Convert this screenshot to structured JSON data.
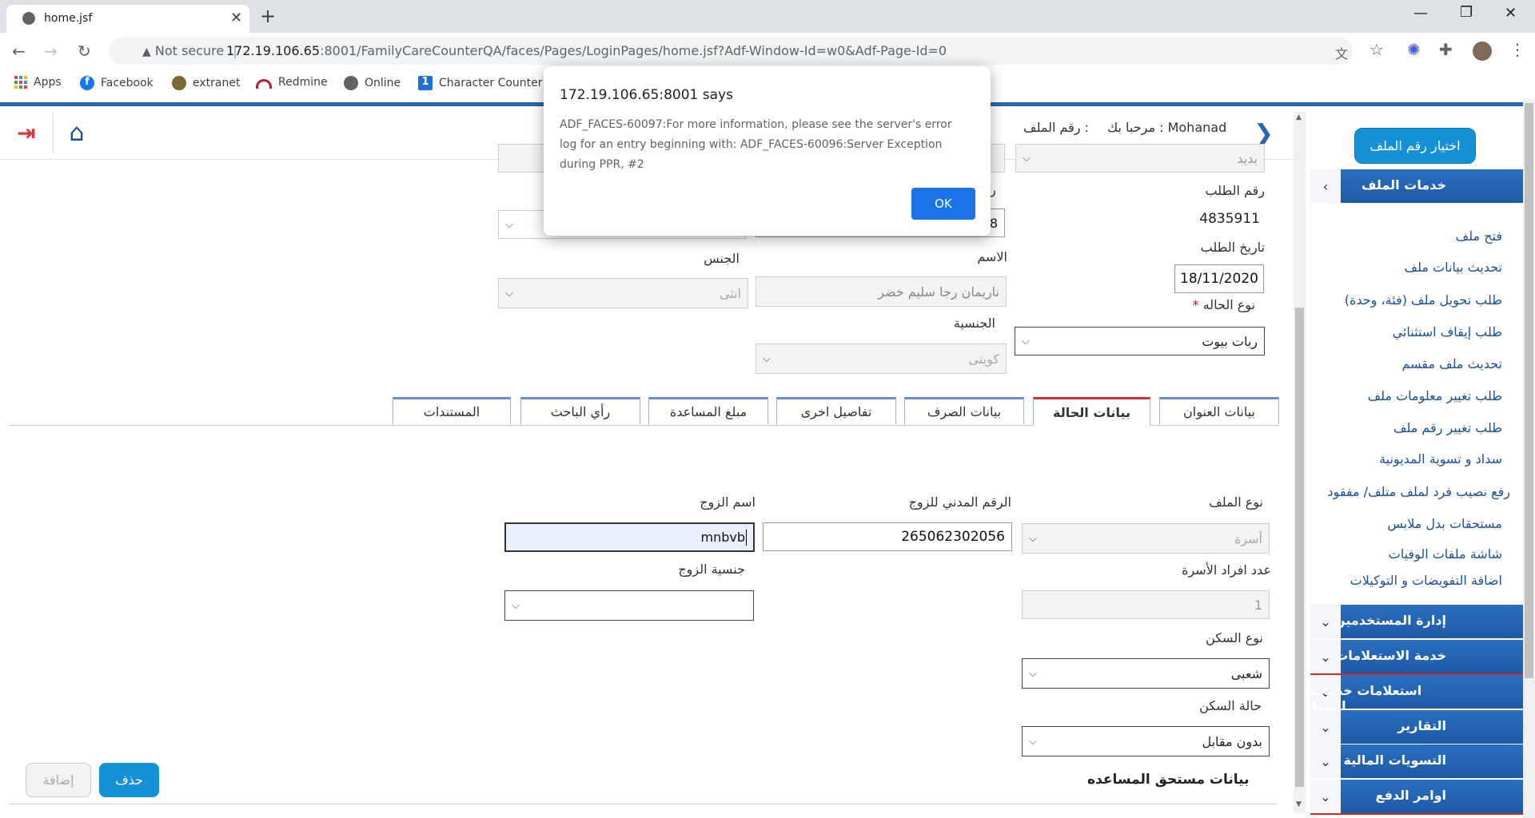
{
  "browser": {
    "tab_title": "home.jsf",
    "not_secure": "Not secure",
    "url_host": "172.19.106.65",
    "url_rest": ":8001/FamilyCareCounterQA/faces/Pages/LoginPages/home.jsf?Adf-Window-Id=w0&Adf-Page-Id=0",
    "bookmarks": [
      "Apps",
      "Facebook",
      "extranet",
      "Redmine",
      "Online",
      "Character Counter"
    ]
  },
  "dialog": {
    "title": "172.19.106.65:8001 says",
    "message": "ADF_FACES-60097:For more information, please see the server's error log for an entry beginning with: ADF_FACES-60096:Server Exception during PPR, #2",
    "ok": "OK"
  },
  "header": {
    "welcome": "مرحبا بك : Mohanad",
    "file_no": "رقم الملف :",
    "file_no_cut": "ا"
  },
  "sidebar": {
    "choose_file": "اختيار رقم الملف",
    "file_services": "خدمات الملف",
    "items": [
      "فتح ملف",
      "تحديث بيانات ملف",
      "طلب تحويل ملف (فئة، وحدة)",
      "طلب إيقاف استثنائي",
      "تحديث ملف مقسم",
      "طلب تغيير معلومات ملف",
      "طلب تغيير رقم ملف",
      "سداد و تسوية المديونية",
      "رفع نصيب فرد لملف متلف/ مفقود",
      "مستحقات بدل ملابس",
      "شاشة ملفات الوفيات",
      "اضافة التفويضات و التوكيلات"
    ],
    "sections": [
      "إدارة المستخدمين",
      "خدمة الاستعلامات",
      "استعلامات خدمات الربط",
      "التقارير",
      "التسويات المالية",
      "اوامر الدفع"
    ]
  },
  "form": {
    "top_field": "بديد",
    "request_no_label": "رقم الطلب",
    "request_no": "4835911",
    "request_date_label": "تاريخ الطلب",
    "request_date": "18/11/2020",
    "case_type_label": "نوع الحاله",
    "case_type": "ربات بيوت",
    "name_label": "الاسم",
    "name_value": "ناريمان رجا سليم خضر",
    "gender_label": "الجنس",
    "gender_value": "انثى",
    "nationality_label": "الجنسية",
    "nationality_value": "كويتى",
    "partial_field": "8",
    "partial_label": "ر"
  },
  "tabs": [
    "بيانات العنوان",
    "بيانات الحالة",
    "بيانات الصرف",
    "تفاصيل اخرى",
    "مبلغ المساعدة",
    "رأي الباحث",
    "المستندات"
  ],
  "case": {
    "file_type_label": "نوع الملف",
    "file_type": "أسرة",
    "husband_civil_label": "الرقم المدني للزوج",
    "husband_civil": "265062302056",
    "husband_name_label": "اسم الزوج",
    "husband_name": "mnbvb",
    "family_count_label": "عدد افراد الأسرة",
    "family_count": "1",
    "husband_nat_label": "جنسية الزوج",
    "husband_nat": "",
    "housing_type_label": "نوع السكن",
    "housing_type": "شعبى",
    "housing_status_label": "حالة السكن",
    "housing_status": "بدون مقابل",
    "beneficiary_heading": "بيانات مستحق المساعده",
    "delete": "حذف",
    "add": "إضافة"
  }
}
